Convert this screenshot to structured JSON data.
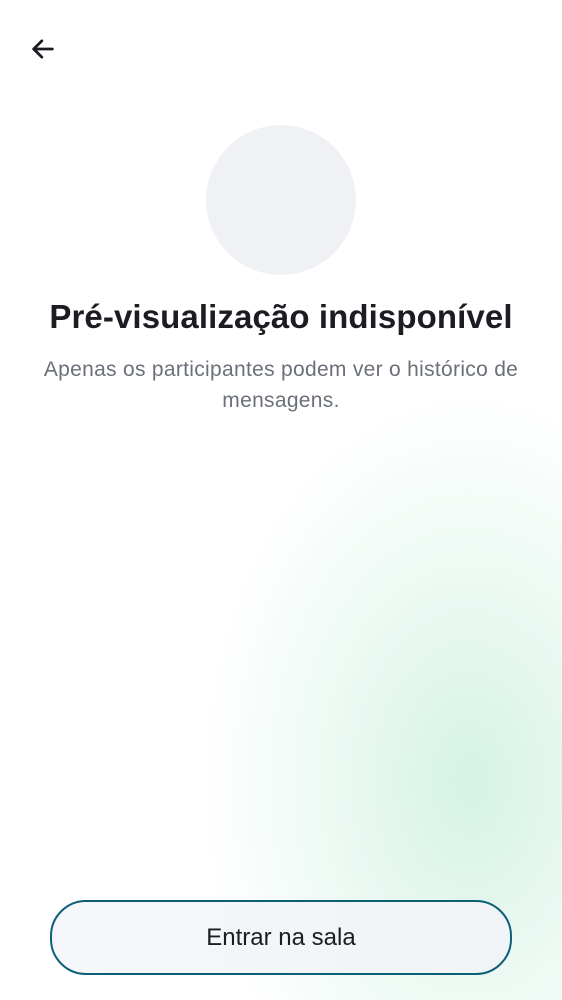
{
  "header": {
    "back_icon": "arrow-left-icon"
  },
  "room": {
    "avatar": "placeholder"
  },
  "content": {
    "title": "Pré-visualização indisponível",
    "subtitle": "Apenas os participantes podem ver o histórico de mensagens."
  },
  "actions": {
    "join_label": "Entrar na sala"
  },
  "colors": {
    "button_border": "#0d5f78",
    "title_text": "#1b1d22",
    "subtitle_text": "#6b7079",
    "avatar_bg": "#f0f1f5"
  }
}
